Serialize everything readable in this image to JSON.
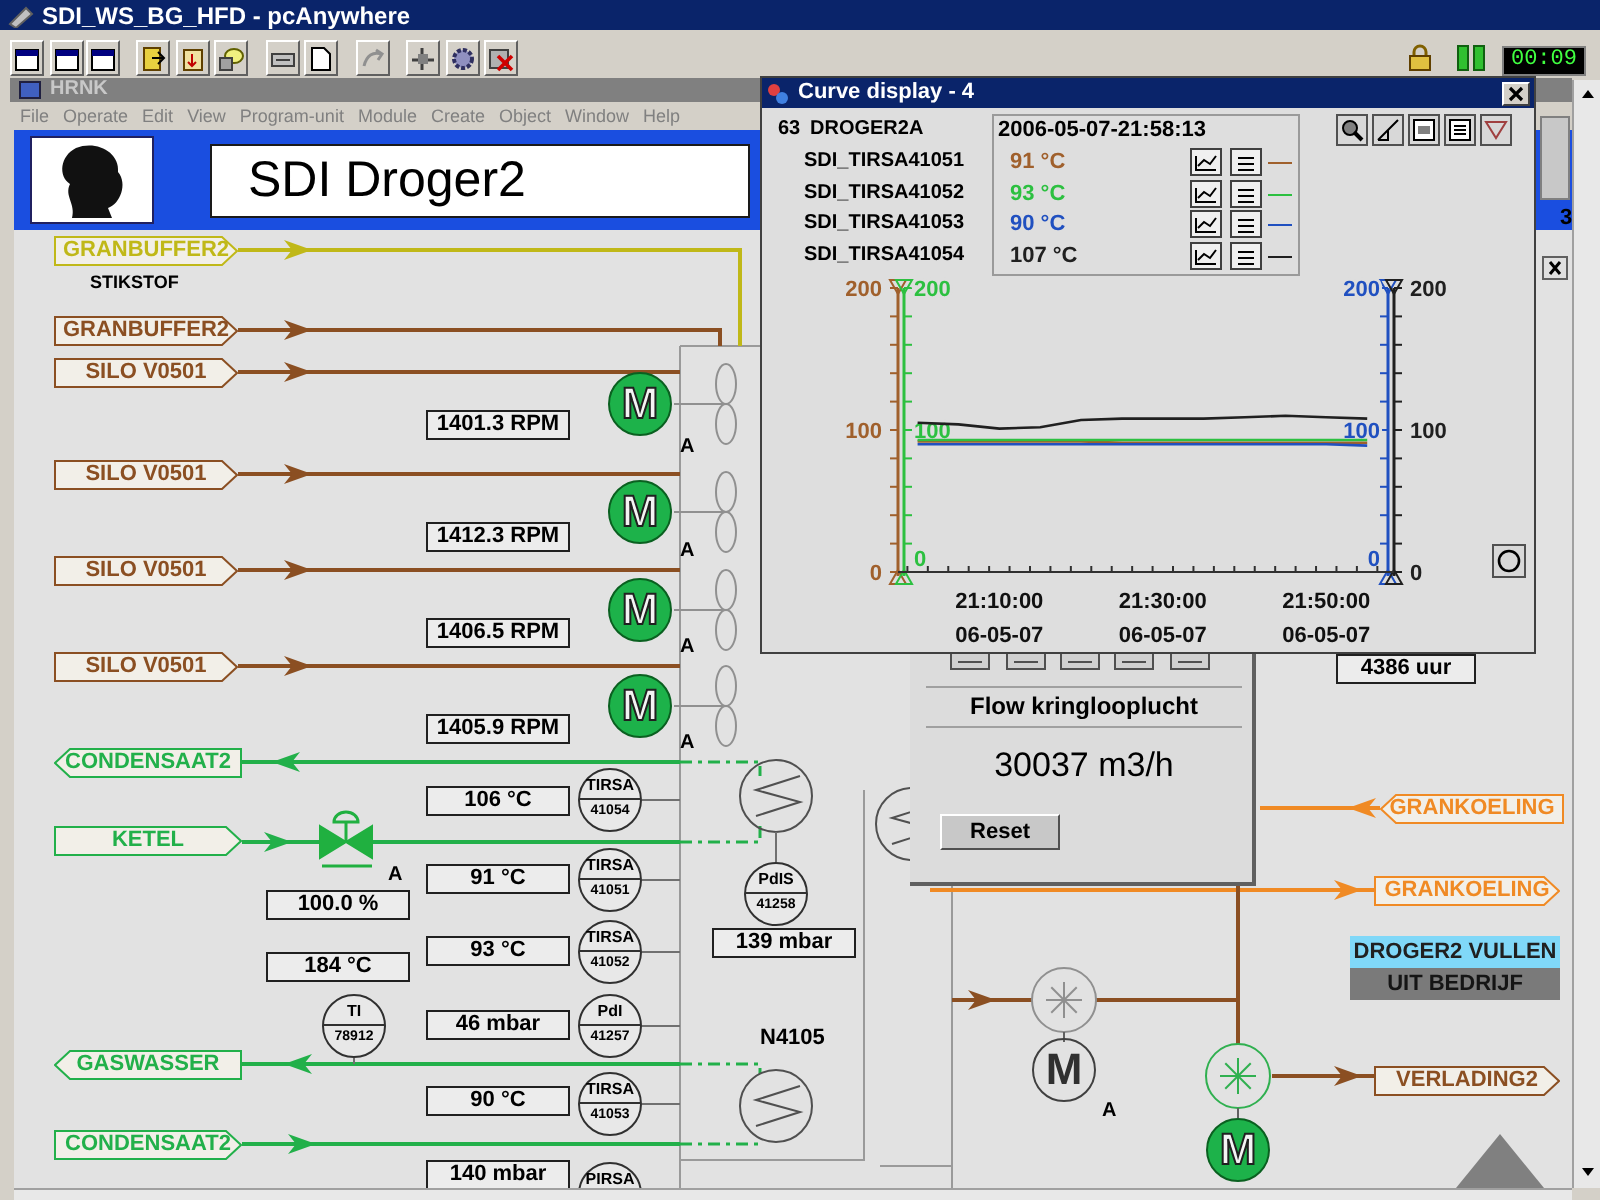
{
  "window": {
    "title": "SDI_WS_BG_HFD - pcAnywhere",
    "clock": "00:09"
  },
  "app_window": {
    "title": "HRNK",
    "menu": [
      "File",
      "Operate",
      "Edit",
      "View",
      "Program-unit",
      "Module",
      "Create",
      "Object",
      "Window",
      "Help"
    ]
  },
  "header": {
    "title": "SDI Droger2"
  },
  "diagram": {
    "streams": [
      {
        "label": "GRANBUFFER2",
        "color": "#c0b818",
        "points_left": false
      },
      {
        "label": "GRANBUFFER2",
        "color": "#8b4f22",
        "points_left": false
      },
      {
        "label": "SILO V0501",
        "color": "#8b4f22",
        "points_left": false
      },
      {
        "label": "SILO V0501",
        "color": "#8b4f22",
        "points_left": false
      },
      {
        "label": "SILO V0501",
        "color": "#8b4f22",
        "points_left": false
      },
      {
        "label": "SILO V0501",
        "color": "#8b4f22",
        "points_left": false
      },
      {
        "label": "CONDENSAAT2",
        "color": "#22b04a",
        "points_left": true
      },
      {
        "label": "KETEL",
        "color": "#22b04a",
        "points_left": false
      },
      {
        "label": "GASWASSER",
        "color": "#22b04a",
        "points_left": true
      },
      {
        "label": "CONDENSAAT2",
        "color": "#22b04a",
        "points_left": false
      },
      {
        "label": "GRANKOELING",
        "color": "#f08a24",
        "points_left": true
      },
      {
        "label": "GRANKOELING",
        "color": "#f08a24",
        "points_left": false
      },
      {
        "label": "VERLADING2",
        "color": "#8b4f22",
        "points_left": false
      }
    ],
    "notes": [
      "STIKSTOF",
      "N4105"
    ],
    "readings": [
      "1401.3 RPM",
      "1412.3 RPM",
      "1406.5 RPM",
      "1405.9 RPM",
      "106 °C",
      "100.0 %",
      "91 °C",
      "93 °C",
      "139 mbar",
      "184 °C",
      "46 mbar",
      "90 °C",
      "140 mbar",
      "4386 uur"
    ],
    "instruments": [
      {
        "type": "TIRSA",
        "number": "41054"
      },
      {
        "type": "TIRSA",
        "number": "41051"
      },
      {
        "type": "PdIS",
        "number": "41258"
      },
      {
        "type": "TIRSA",
        "number": "41052"
      },
      {
        "type": "TI",
        "number": "78912"
      },
      {
        "type": "PdI",
        "number": "41257"
      },
      {
        "type": "TIRSA",
        "number": "41053"
      },
      {
        "type": "PIRSA"
      }
    ],
    "motors": [
      {
        "symbol": "M",
        "running": true,
        "mode": "A"
      },
      {
        "symbol": "M",
        "running": true,
        "mode": "A"
      },
      {
        "symbol": "M",
        "running": true,
        "mode": "A"
      },
      {
        "symbol": "M",
        "running": true,
        "mode": "A"
      },
      {
        "symbol": "M",
        "running": false,
        "mode": "A"
      },
      {
        "symbol": "M",
        "running": true
      }
    ],
    "rotary_valves": [
      {
        "running": false
      },
      {
        "running": true
      }
    ],
    "valve": {
      "active": true,
      "mode": "A"
    },
    "status": {
      "title": "DROGER2 VULLEN",
      "state": "UIT BEDRIJF",
      "active": false
    },
    "side_label": "3"
  },
  "flow_panel": {
    "title": "Flow kringlooplucht",
    "value": "30037 m3/h",
    "button": "Reset"
  },
  "curve_window": {
    "title": "Curve display - 4",
    "number": "63",
    "group": "DROGER2A",
    "timestamp": "2006-05-07-21:58:13",
    "rows": [
      {
        "value": "91 °C",
        "color": "#a0602c"
      },
      {
        "value": "93 °C",
        "color": "#2cc040"
      },
      {
        "value": "90 °C",
        "color": "#2050c0"
      },
      {
        "value": "107 °C",
        "color": "#202020"
      }
    ],
    "x_dates": [
      "06-05-07",
      "06-05-07",
      "06-05-07"
    ],
    "y_axes": [
      {
        "labels": [
          "200",
          "100",
          "0"
        ]
      },
      {
        "labels": [
          "200",
          "100",
          "0"
        ]
      },
      {
        "labels": [
          "200",
          "100",
          "0"
        ]
      },
      {
        "labels": [
          "200",
          "100",
          "0"
        ]
      }
    ],
    "chart_data": {
      "type": "line",
      "categories": [
        null,
        null,
        "21:10:00",
        null,
        null,
        null,
        "21:30:00",
        null,
        null,
        null,
        "21:50:00",
        null
      ],
      "ylim": [
        0,
        200
      ],
      "yticks": [
        0,
        100,
        200
      ],
      "series": [
        {
          "name": "SDI_TIRSA41051",
          "color": "#a0602c",
          "values": [
            92,
            92,
            92,
            92,
            92,
            91,
            91,
            91,
            91,
            91,
            91,
            91
          ]
        },
        {
          "name": "SDI_TIRSA41052",
          "color": "#2cc040",
          "values": [
            93,
            93,
            93,
            93,
            93,
            93,
            93,
            93,
            93,
            93,
            93,
            93
          ]
        },
        {
          "name": "SDI_TIRSA41053",
          "color": "#2050c0",
          "values": [
            90,
            90,
            90,
            90,
            90,
            90,
            90,
            90,
            90,
            90,
            90,
            89
          ]
        },
        {
          "name": "SDI_TIRSA41054",
          "color": "#202020",
          "values": [
            105,
            104,
            101,
            102,
            107,
            108,
            108,
            108,
            109,
            110,
            109,
            108
          ]
        }
      ]
    }
  }
}
